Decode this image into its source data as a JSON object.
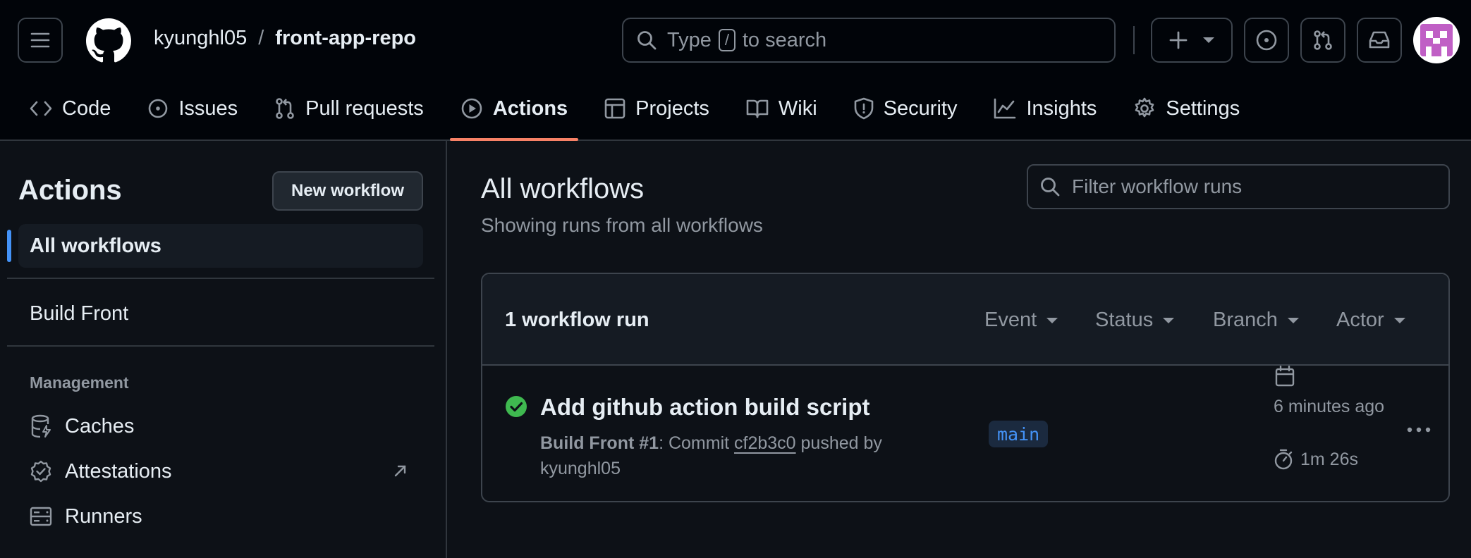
{
  "header": {
    "owner": "kyunghl05",
    "separator": "/",
    "repo": "front-app-repo",
    "search_prefix": "Type",
    "search_key": "/",
    "search_suffix": "to search"
  },
  "repo_nav": {
    "tabs": [
      {
        "label": "Code",
        "icon": "code-icon"
      },
      {
        "label": "Issues",
        "icon": "issue-icon"
      },
      {
        "label": "Pull requests",
        "icon": "pull-request-icon"
      },
      {
        "label": "Actions",
        "icon": "play-icon",
        "active": true
      },
      {
        "label": "Projects",
        "icon": "table-icon"
      },
      {
        "label": "Wiki",
        "icon": "book-icon"
      },
      {
        "label": "Security",
        "icon": "shield-icon"
      },
      {
        "label": "Insights",
        "icon": "graph-icon"
      },
      {
        "label": "Settings",
        "icon": "gear-icon"
      }
    ]
  },
  "sidebar": {
    "title": "Actions",
    "new_workflow_label": "New workflow",
    "all_workflows_label": "All workflows",
    "workflows": [
      "Build Front"
    ],
    "management_heading": "Management",
    "management_items": [
      {
        "label": "Caches",
        "icon": "database-icon"
      },
      {
        "label": "Attestations",
        "icon": "verified-icon"
      },
      {
        "label": "Runners",
        "icon": "server-icon"
      }
    ]
  },
  "main": {
    "title": "All workflows",
    "subtitle": "Showing runs from all workflows",
    "filter_placeholder": "Filter workflow runs",
    "runs_count": "1 workflow run",
    "filters": [
      "Event",
      "Status",
      "Branch",
      "Actor"
    ],
    "runs": [
      {
        "title": "Add github action build script",
        "workflow": "Build Front #1",
        "commit_prefix": ": Commit",
        "sha": "cf2b3c0",
        "pushed_by": "pushed by",
        "actor": "kyunghl05",
        "branch": "main",
        "time_ago": "6 minutes ago",
        "duration": "1m 26s",
        "status": "success"
      }
    ]
  },
  "colors": {
    "accent_underline": "#f78166",
    "success": "#3fb950",
    "link": "#4493f8"
  }
}
